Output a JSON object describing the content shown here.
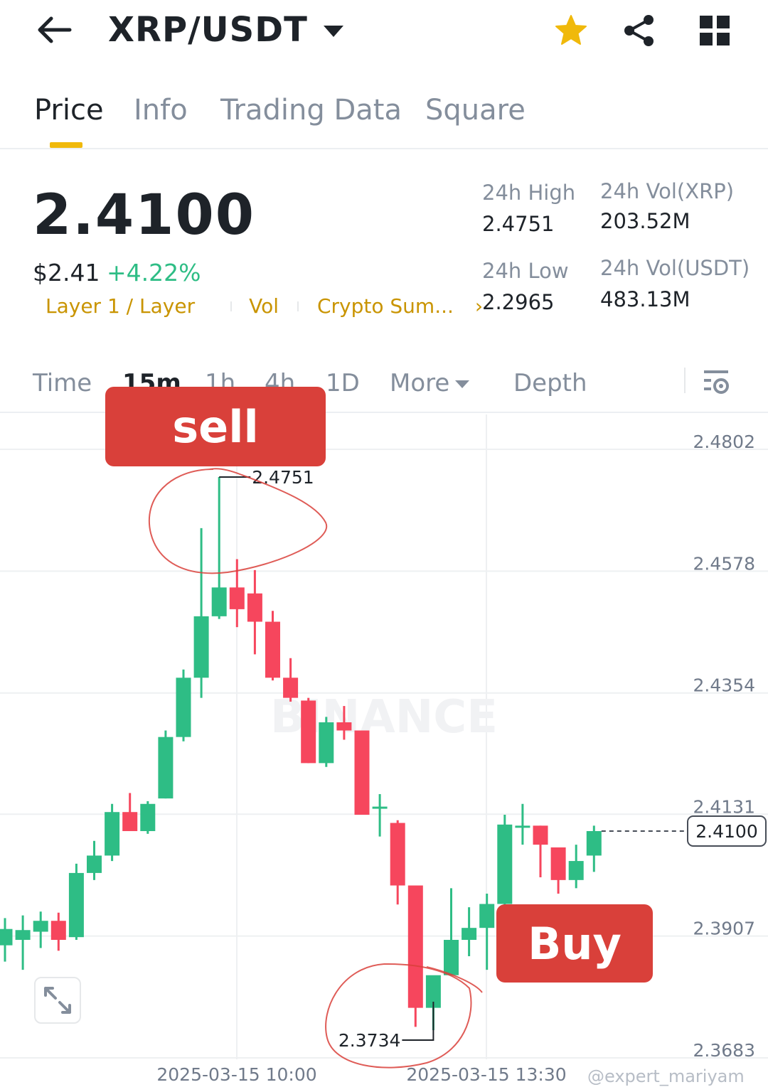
{
  "header": {
    "pair": "XRP/USDT",
    "icons": [
      "back-arrow-icon",
      "caret-down-icon",
      "star-icon",
      "share-icon",
      "grid-icon"
    ],
    "star_color": "#f0b90b"
  },
  "tabs": [
    {
      "label": "Price",
      "active": true
    },
    {
      "label": "Info",
      "active": false
    },
    {
      "label": "Trading Data",
      "active": false
    },
    {
      "label": "Square",
      "active": false
    }
  ],
  "price": {
    "last": "2.4100",
    "usd": "$2.41",
    "change": "+4.22%",
    "tags": [
      "Layer 1 / Layer",
      "Vol",
      "Crypto Sum..."
    ],
    "stats": {
      "high_label": "24h High",
      "high": "2.4751",
      "low_label": "24h Low",
      "low": "2.2965",
      "vol_xrp_label": "24h Vol(XRP)",
      "vol_xrp": "203.52M",
      "vol_usdt_label": "24h Vol(USDT)",
      "vol_usdt": "483.13M"
    }
  },
  "intervals": {
    "items": [
      "Time",
      "15m",
      "1h",
      "4h",
      "1D",
      "More",
      "Depth"
    ],
    "active": "15m"
  },
  "colors": {
    "up": "#2ebd85",
    "down": "#f6465d",
    "accent": "#f0b90b",
    "annotation": "#d9403a"
  },
  "annotations": {
    "sell": "sell",
    "buy": "Buy"
  },
  "watermark": "@expert_mariyam",
  "chart_data": {
    "type": "candlestick",
    "interval": "15m",
    "y_ticks": [
      "2.4802",
      "2.4578",
      "2.4354",
      "2.4131",
      "2.3907",
      "2.3683"
    ],
    "ylim": [
      2.365,
      2.484
    ],
    "x_ticks": [
      "2025-03-15 10:00",
      "2025-03-15 13:30"
    ],
    "last_price_label": "2.4100",
    "high_marker": "2.4751",
    "low_marker": "2.3734",
    "watermark_text": "BINANCE",
    "candles": [
      {
        "o": 2.389,
        "h": 2.394,
        "l": 2.386,
        "c": 2.392
      },
      {
        "o": 2.39,
        "h": 2.3945,
        "l": 2.3845,
        "c": 2.3918
      },
      {
        "o": 2.3915,
        "h": 2.3952,
        "l": 2.3885,
        "c": 2.3935
      },
      {
        "o": 2.3935,
        "h": 2.395,
        "l": 2.388,
        "c": 2.39
      },
      {
        "o": 2.3905,
        "h": 2.404,
        "l": 2.39,
        "c": 2.4023
      },
      {
        "o": 2.4023,
        "h": 2.4082,
        "l": 2.401,
        "c": 2.4055
      },
      {
        "o": 2.4055,
        "h": 2.415,
        "l": 2.4045,
        "c": 2.4135
      },
      {
        "o": 2.4135,
        "h": 2.417,
        "l": 2.4105,
        "c": 2.41
      },
      {
        "o": 2.41,
        "h": 2.4155,
        "l": 2.4095,
        "c": 2.415
      },
      {
        "o": 2.416,
        "h": 2.4285,
        "l": 2.416,
        "c": 2.4273
      },
      {
        "o": 2.4273,
        "h": 2.4397,
        "l": 2.4265,
        "c": 2.4382
      },
      {
        "o": 2.4382,
        "h": 2.4657,
        "l": 2.4345,
        "c": 2.4495
      },
      {
        "o": 2.4495,
        "h": 2.4751,
        "l": 2.449,
        "c": 2.4548
      },
      {
        "o": 2.4548,
        "h": 2.46,
        "l": 2.4475,
        "c": 2.4508
      },
      {
        "o": 2.4537,
        "h": 2.458,
        "l": 2.4425,
        "c": 2.4485
      },
      {
        "o": 2.4485,
        "h": 2.4505,
        "l": 2.4377,
        "c": 2.4382
      },
      {
        "o": 2.4382,
        "h": 2.4418,
        "l": 2.4338,
        "c": 2.4345
      },
      {
        "o": 2.434,
        "h": 2.4345,
        "l": 2.4225,
        "c": 2.4225
      },
      {
        "o": 2.4225,
        "h": 2.431,
        "l": 2.4218,
        "c": 2.43
      },
      {
        "o": 2.43,
        "h": 2.433,
        "l": 2.4268,
        "c": 2.4285
      },
      {
        "o": 2.4285,
        "h": 2.4285,
        "l": 2.413,
        "c": 2.413
      },
      {
        "o": 2.4145,
        "h": 2.4168,
        "l": 2.409,
        "c": 2.4145
      },
      {
        "o": 2.4115,
        "h": 2.412,
        "l": 2.3965,
        "c": 2.4
      },
      {
        "o": 2.4,
        "h": 2.4,
        "l": 2.374,
        "c": 2.3775
      },
      {
        "o": 2.3775,
        "h": 2.3815,
        "l": 2.3734,
        "c": 2.3835
      },
      {
        "o": 2.3835,
        "h": 2.3995,
        "l": 2.3835,
        "c": 2.39
      },
      {
        "o": 2.39,
        "h": 2.396,
        "l": 2.387,
        "c": 2.3922
      },
      {
        "o": 2.3922,
        "h": 2.3985,
        "l": 2.3845,
        "c": 2.3966
      },
      {
        "o": 2.3966,
        "h": 2.413,
        "l": 2.3955,
        "c": 2.4112
      },
      {
        "o": 2.411,
        "h": 2.415,
        "l": 2.4075,
        "c": 2.411
      },
      {
        "o": 2.411,
        "h": 2.411,
        "l": 2.4015,
        "c": 2.4075
      },
      {
        "o": 2.407,
        "h": 2.407,
        "l": 2.3985,
        "c": 2.401
      },
      {
        "o": 2.401,
        "h": 2.4075,
        "l": 2.3995,
        "c": 2.4045
      },
      {
        "o": 2.4055,
        "h": 2.411,
        "l": 2.4025,
        "c": 2.41
      }
    ]
  }
}
